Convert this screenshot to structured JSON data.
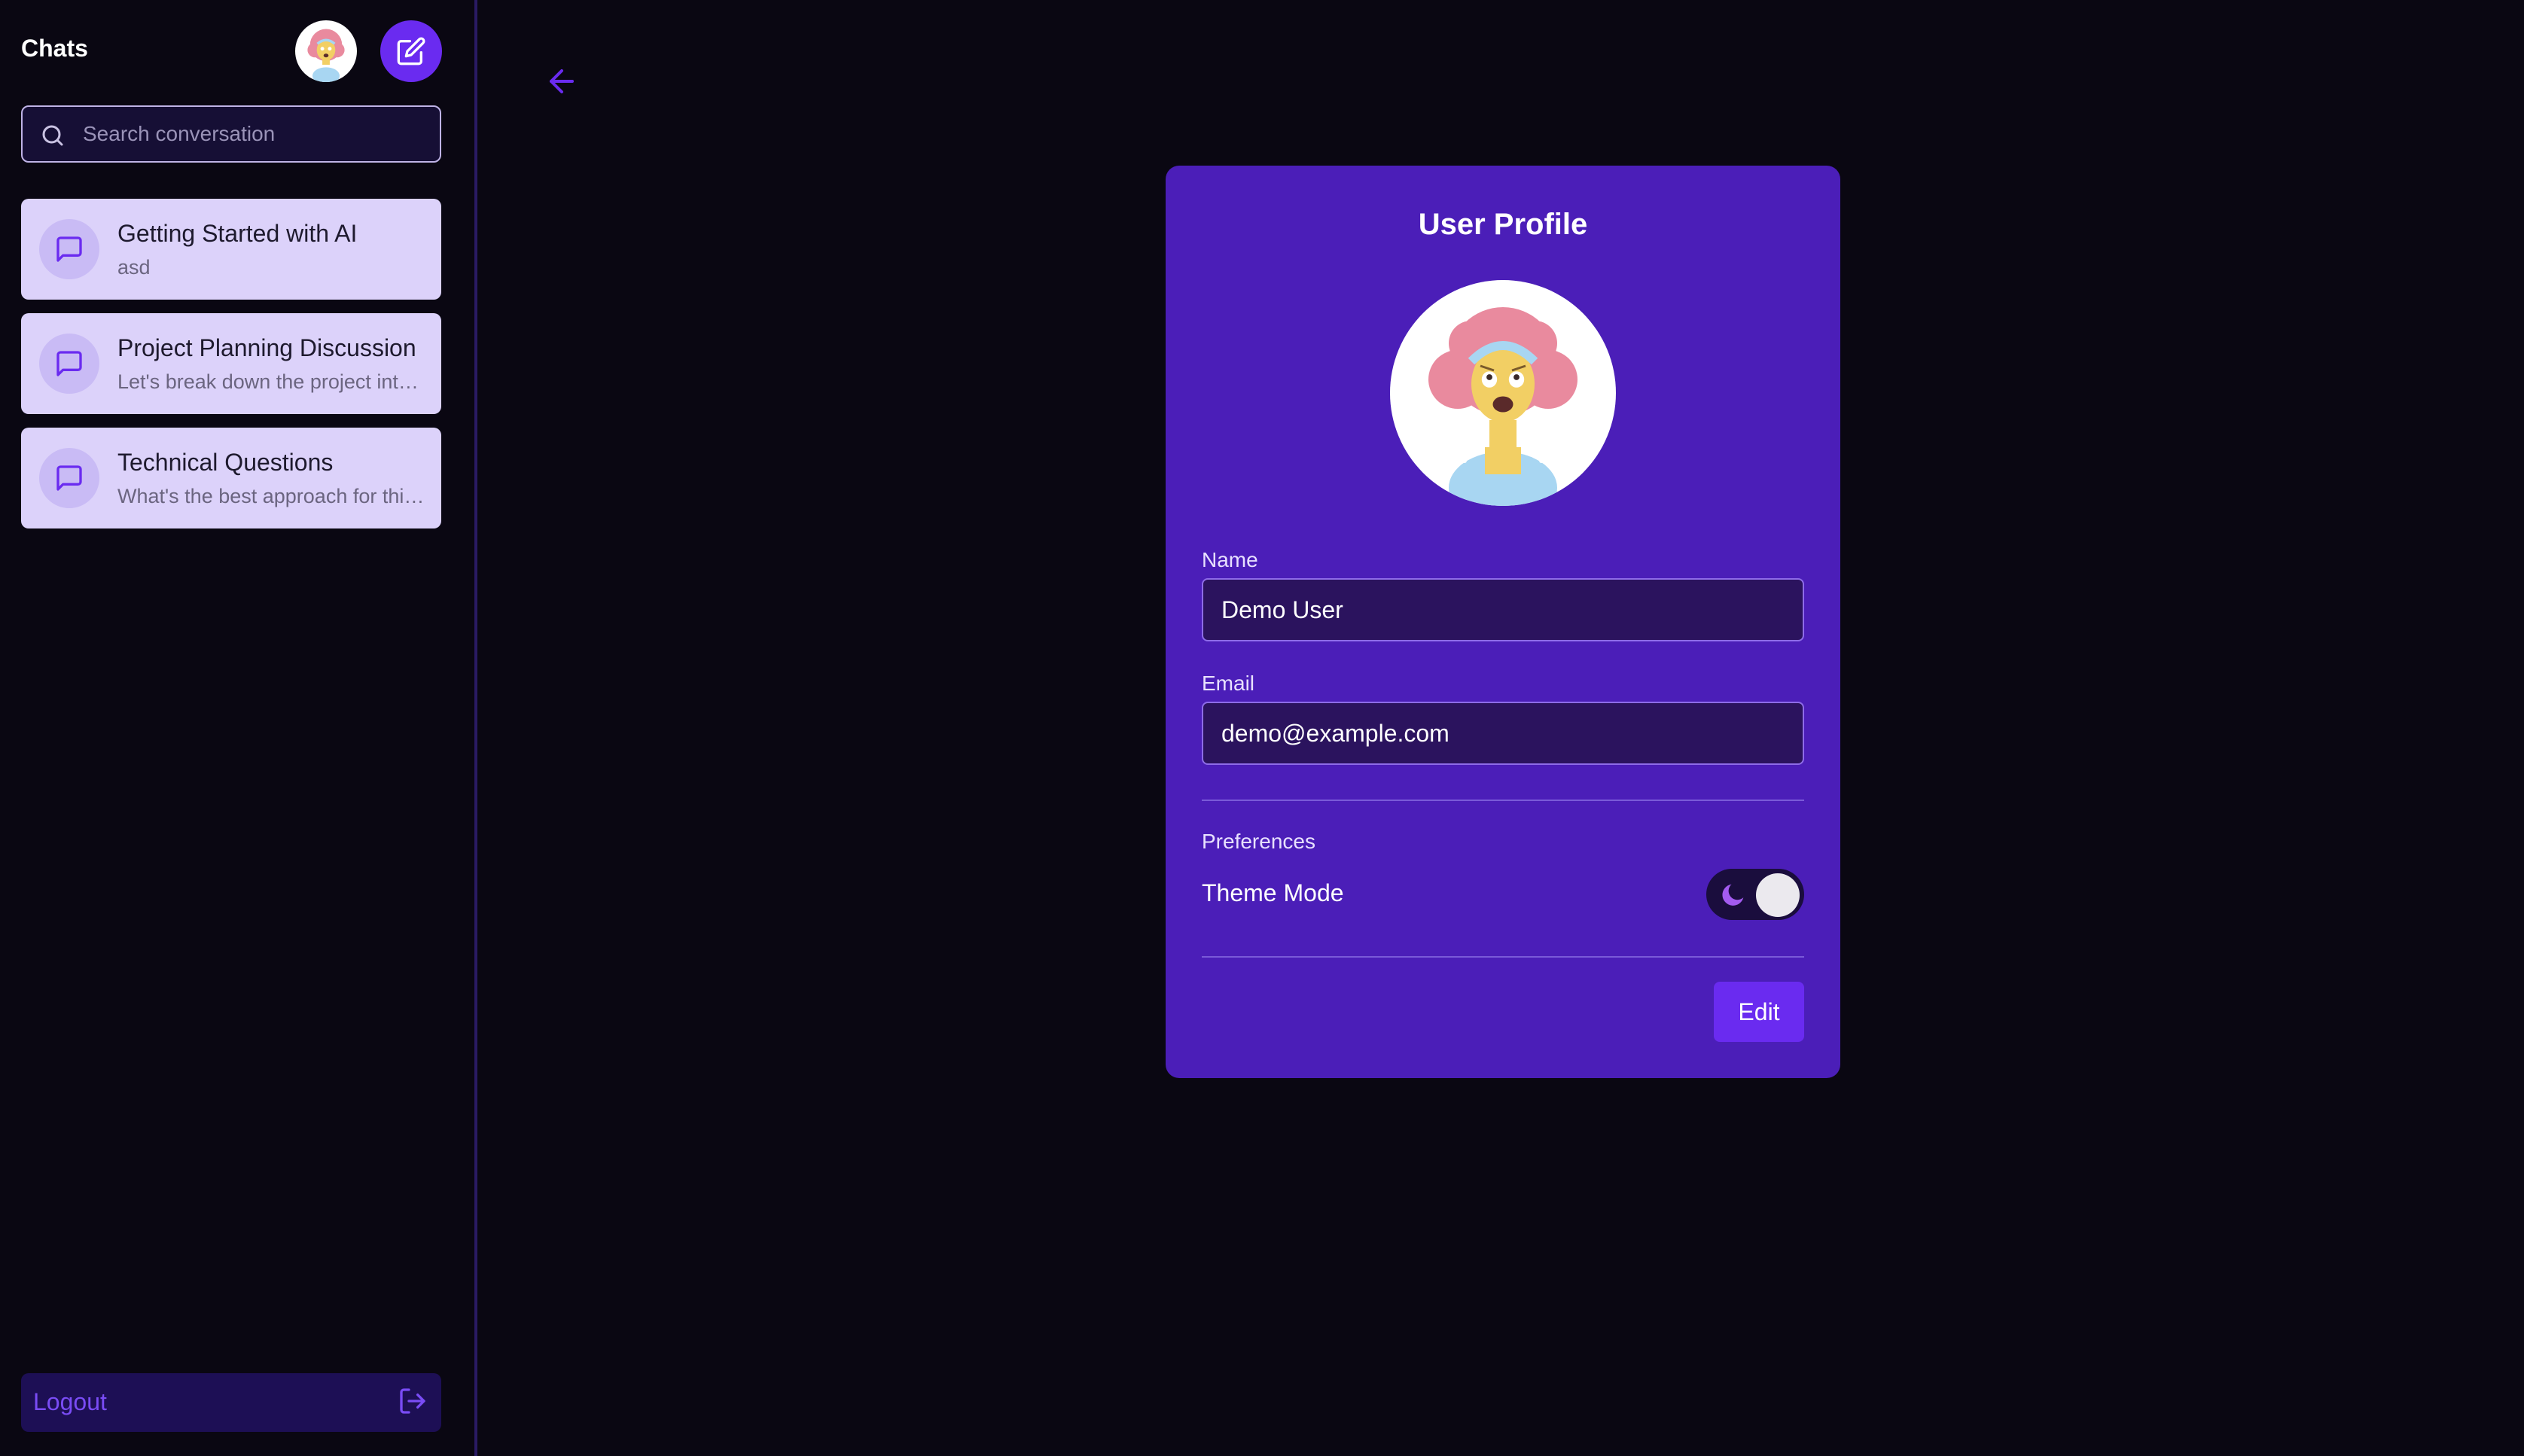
{
  "sidebar": {
    "title": "Chats",
    "search": {
      "placeholder": "Search conversation",
      "value": ""
    },
    "chats": [
      {
        "title": "Getting Started with AI",
        "preview": "asd"
      },
      {
        "title": "Project Planning Discussion",
        "preview": "Let's break down the project into manageable tasks"
      },
      {
        "title": "Technical Questions",
        "preview": "What's the best approach for this problem?"
      }
    ],
    "logout_label": "Logout"
  },
  "profile": {
    "title": "User Profile",
    "name_label": "Name",
    "name_value": "Demo User",
    "email_label": "Email",
    "email_value": "demo@example.com",
    "preferences_label": "Preferences",
    "theme_label": "Theme Mode",
    "theme_dark": true,
    "edit_label": "Edit"
  },
  "colors": {
    "background": "#0a0712",
    "accent": "#6a2bf0",
    "card": "#4b1eb8",
    "chat_item": "#dcd2fa"
  },
  "icons": {
    "new_chat": "edit-square-icon",
    "search": "search-icon",
    "chat": "message-square-icon",
    "logout": "logout-icon",
    "back": "arrow-left-icon",
    "theme": "moon-icon"
  }
}
